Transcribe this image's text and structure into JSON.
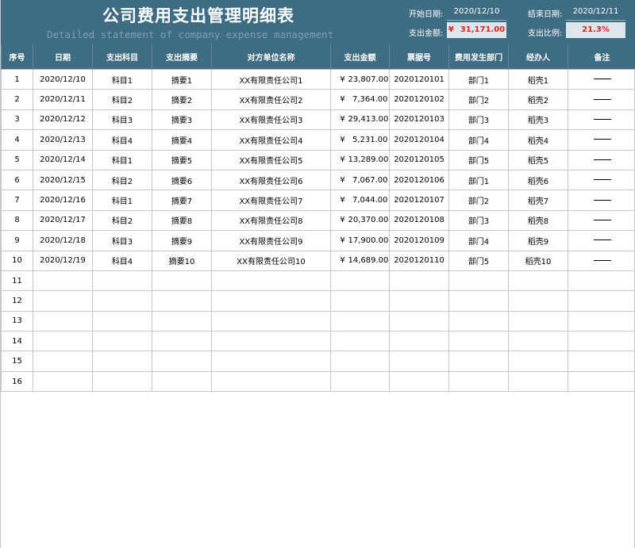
{
  "header": {
    "title": "公司费用支出管理明细表",
    "subtitle": "Detailed statement of company expense management",
    "start_date_label": "开始日期:",
    "start_date": "2020/12/10",
    "end_date_label": "结束日期:",
    "end_date": "2020/12/11",
    "amount_label": "支出金额:",
    "amount_currency": "¥",
    "amount_value": "31,171.00",
    "ratio_label": "支出比例:",
    "ratio_value": "21.3%"
  },
  "table": {
    "columns": [
      "序号",
      "日期",
      "支出科目",
      "支出摘要",
      "对方单位名称",
      "支出金额",
      "票据号",
      "费用发生部门",
      "经办人",
      "备注"
    ],
    "currency": "¥",
    "rows": [
      {
        "no": "1",
        "date": "2020/12/10",
        "subject": "科目1",
        "summary": "摘要1",
        "unit": "XX有限责任公司1",
        "amount": "23,807.00",
        "bill": "2020120101",
        "dept": "部门1",
        "handler": "稻壳1"
      },
      {
        "no": "2",
        "date": "2020/12/11",
        "subject": "科目2",
        "summary": "摘要2",
        "unit": "XX有限责任公司2",
        "amount": "7,364.00",
        "bill": "2020120102",
        "dept": "部门2",
        "handler": "稻壳2"
      },
      {
        "no": "3",
        "date": "2020/12/12",
        "subject": "科目3",
        "summary": "摘要3",
        "unit": "XX有限责任公司3",
        "amount": "29,413.00",
        "bill": "2020120103",
        "dept": "部门3",
        "handler": "稻壳3"
      },
      {
        "no": "4",
        "date": "2020/12/13",
        "subject": "科目4",
        "summary": "摘要4",
        "unit": "XX有限责任公司4",
        "amount": "5,231.00",
        "bill": "2020120104",
        "dept": "部门4",
        "handler": "稻壳4"
      },
      {
        "no": "5",
        "date": "2020/12/14",
        "subject": "科目1",
        "summary": "摘要5",
        "unit": "XX有限责任公司5",
        "amount": "13,289.00",
        "bill": "2020120105",
        "dept": "部门5",
        "handler": "稻壳5"
      },
      {
        "no": "6",
        "date": "2020/12/15",
        "subject": "科目2",
        "summary": "摘要6",
        "unit": "XX有限责任公司6",
        "amount": "7,067.00",
        "bill": "2020120106",
        "dept": "部门1",
        "handler": "稻壳6"
      },
      {
        "no": "7",
        "date": "2020/12/16",
        "subject": "科目1",
        "summary": "摘要7",
        "unit": "XX有限责任公司7",
        "amount": "7,044.00",
        "bill": "2020120107",
        "dept": "部门2",
        "handler": "稻壳7"
      },
      {
        "no": "8",
        "date": "2020/12/17",
        "subject": "科目2",
        "summary": "摘要8",
        "unit": "XX有限责任公司8",
        "amount": "20,370.00",
        "bill": "2020120108",
        "dept": "部门3",
        "handler": "稻壳8"
      },
      {
        "no": "9",
        "date": "2020/12/18",
        "subject": "科目3",
        "summary": "摘要9",
        "unit": "XX有限责任公司9",
        "amount": "17,900.00",
        "bill": "2020120109",
        "dept": "部门4",
        "handler": "稻壳9"
      },
      {
        "no": "10",
        "date": "2020/12/19",
        "subject": "科目4",
        "summary": "摘要10",
        "unit": "XX有限责任公司10",
        "amount": "14,689.00",
        "bill": "2020120110",
        "dept": "部门5",
        "handler": "稻壳10"
      }
    ],
    "empty_rows": [
      "11",
      "12",
      "13",
      "14",
      "15",
      "16"
    ]
  },
  "colors": {
    "header_bg": "#3e6c83",
    "highlight_red": "#e02020",
    "box_bg": "#dde6ea"
  }
}
